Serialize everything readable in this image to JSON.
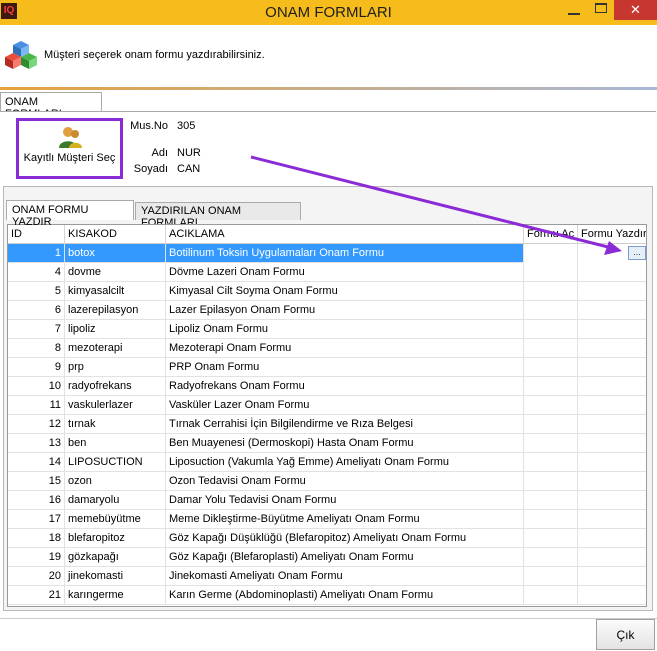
{
  "window": {
    "app_icon_text": "IQ",
    "title": "ONAM FORMLARI",
    "close_glyph": "✕"
  },
  "header": {
    "icon": "cubes-icon",
    "text": "Müşteri seçerek onam formu yazdırabilirsiniz."
  },
  "outer_tab": {
    "label": "ONAM FORMLARI"
  },
  "customer": {
    "select_button_label": "Kayıtlı Müşteri Seç",
    "mus_no_label": "Mus.No",
    "mus_no_value": "305",
    "adi_label": "Adı",
    "adi_value": "NUR",
    "soyadi_label": "Soyadı",
    "soyadi_value": "CAN"
  },
  "tabs": [
    {
      "label": "ONAM FORMU YAZDIR",
      "active": true
    },
    {
      "label": "YAZDIRILAN ONAM FORMLARI",
      "active": false
    }
  ],
  "grid": {
    "columns": [
      "ID",
      "KISAKOD",
      "ACIKLAMA",
      "Formu Aç",
      "Formu Yazdır"
    ],
    "rows": [
      {
        "id": "1",
        "kisakod": "botox",
        "aciklama": "Botilinum Toksin Uygulamaları Onam Formu",
        "selected": true
      },
      {
        "id": "4",
        "kisakod": "dovme",
        "aciklama": "Dövme Lazeri Onam Formu"
      },
      {
        "id": "5",
        "kisakod": "kimyasalcilt",
        "aciklama": "Kimyasal Cilt Soyma Onam Formu"
      },
      {
        "id": "6",
        "kisakod": "lazerepilasyon",
        "aciklama": "Lazer Epilasyon Onam Formu"
      },
      {
        "id": "7",
        "kisakod": "lipoliz",
        "aciklama": "Lipoliz Onam Formu"
      },
      {
        "id": "8",
        "kisakod": "mezoterapi",
        "aciklama": "Mezoterapi Onam Formu"
      },
      {
        "id": "9",
        "kisakod": "prp",
        "aciklama": "PRP Onam Formu"
      },
      {
        "id": "10",
        "kisakod": "radyofrekans",
        "aciklama": "Radyofrekans Onam Formu"
      },
      {
        "id": "11",
        "kisakod": "vaskulerlazer",
        "aciklama": "Vasküler Lazer Onam Formu"
      },
      {
        "id": "12",
        "kisakod": "tırnak",
        "aciklama": "Tırnak Cerrahisi İçin Bilgilendirme ve Rıza Belgesi"
      },
      {
        "id": "13",
        "kisakod": "ben",
        "aciklama": "Ben Muayenesi (Dermoskopi) Hasta Onam Formu"
      },
      {
        "id": "14",
        "kisakod": "LIPOSUCTION",
        "aciklama": "Liposuction (Vakumla Yağ Emme) Ameliyatı Onam Formu"
      },
      {
        "id": "15",
        "kisakod": "ozon",
        "aciklama": "Ozon Tedavisi Onam Formu"
      },
      {
        "id": "16",
        "kisakod": "damaryolu",
        "aciklama": "Damar Yolu Tedavisi Onam Formu"
      },
      {
        "id": "17",
        "kisakod": "memebüyütme",
        "aciklama": "Meme Dikleştirme-Büyütme Ameliyatı Onam Formu"
      },
      {
        "id": "18",
        "kisakod": "blefaropitoz",
        "aciklama": "Göz Kapağı Düşüklüğü (Blefaropitoz) Ameliyatı Onam Formu"
      },
      {
        "id": "19",
        "kisakod": "gözkapağı",
        "aciklama": "Göz Kapağı (Blefaroplasti) Ameliyatı Onam Formu"
      },
      {
        "id": "20",
        "kisakod": "jinekomasti",
        "aciklama": "Jinekomasti Ameliyatı Onam Formu"
      },
      {
        "id": "21",
        "kisakod": "karıngerme",
        "aciklama": "Karın Germe (Abdominoplasti) Ameliyatı Onam Formu"
      }
    ],
    "ellipsis_label": "..."
  },
  "footer": {
    "close_button_label": "Çık"
  },
  "colors": {
    "titlebar": "#f6bc1c",
    "selection": "#3399ff",
    "annotation": "#8b2bd6"
  }
}
